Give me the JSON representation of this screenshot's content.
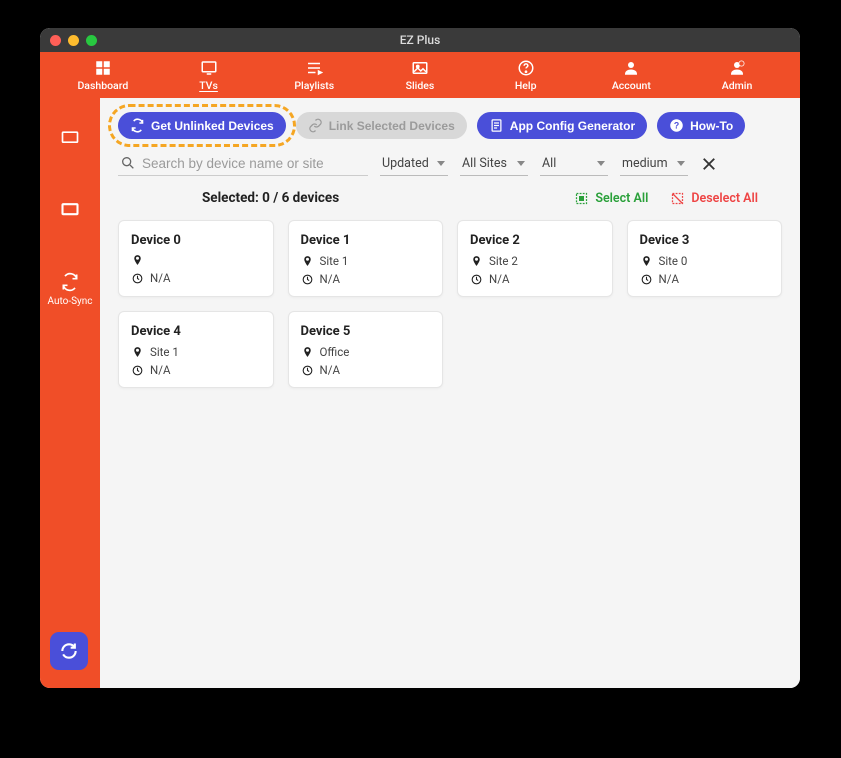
{
  "window": {
    "title": "EZ Plus"
  },
  "topnav": [
    {
      "label": "Dashboard"
    },
    {
      "label": "TVs",
      "active": true
    },
    {
      "label": "Playlists"
    },
    {
      "label": "Slides"
    },
    {
      "label": "Help"
    },
    {
      "label": "Account"
    },
    {
      "label": "Admin"
    }
  ],
  "sidebar": {
    "items": [
      {
        "label": ""
      },
      {
        "label": ""
      },
      {
        "label": "Auto-Sync"
      }
    ]
  },
  "toolbar": {
    "get_unlinked": "Get Unlinked Devices",
    "link_selected": "Link Selected Devices",
    "app_config": "App Config Generator",
    "howto": "How-To"
  },
  "search": {
    "placeholder": "Search by device name or site"
  },
  "filters": {
    "sort": "Updated",
    "site": "All Sites",
    "status": "All",
    "size": "medium"
  },
  "selection": {
    "text": "Selected: 0 / 6 devices",
    "select_all": "Select All",
    "deselect_all": "Deselect All"
  },
  "devices": [
    {
      "name": "Device 0",
      "site": "",
      "status": "N/A"
    },
    {
      "name": "Device 1",
      "site": "Site 1",
      "status": "N/A"
    },
    {
      "name": "Device 2",
      "site": "Site 2",
      "status": "N/A"
    },
    {
      "name": "Device 3",
      "site": "Site 0",
      "status": "N/A"
    },
    {
      "name": "Device 4",
      "site": "Site 1",
      "status": "N/A"
    },
    {
      "name": "Device 5",
      "site": "Office",
      "status": "N/A"
    }
  ]
}
